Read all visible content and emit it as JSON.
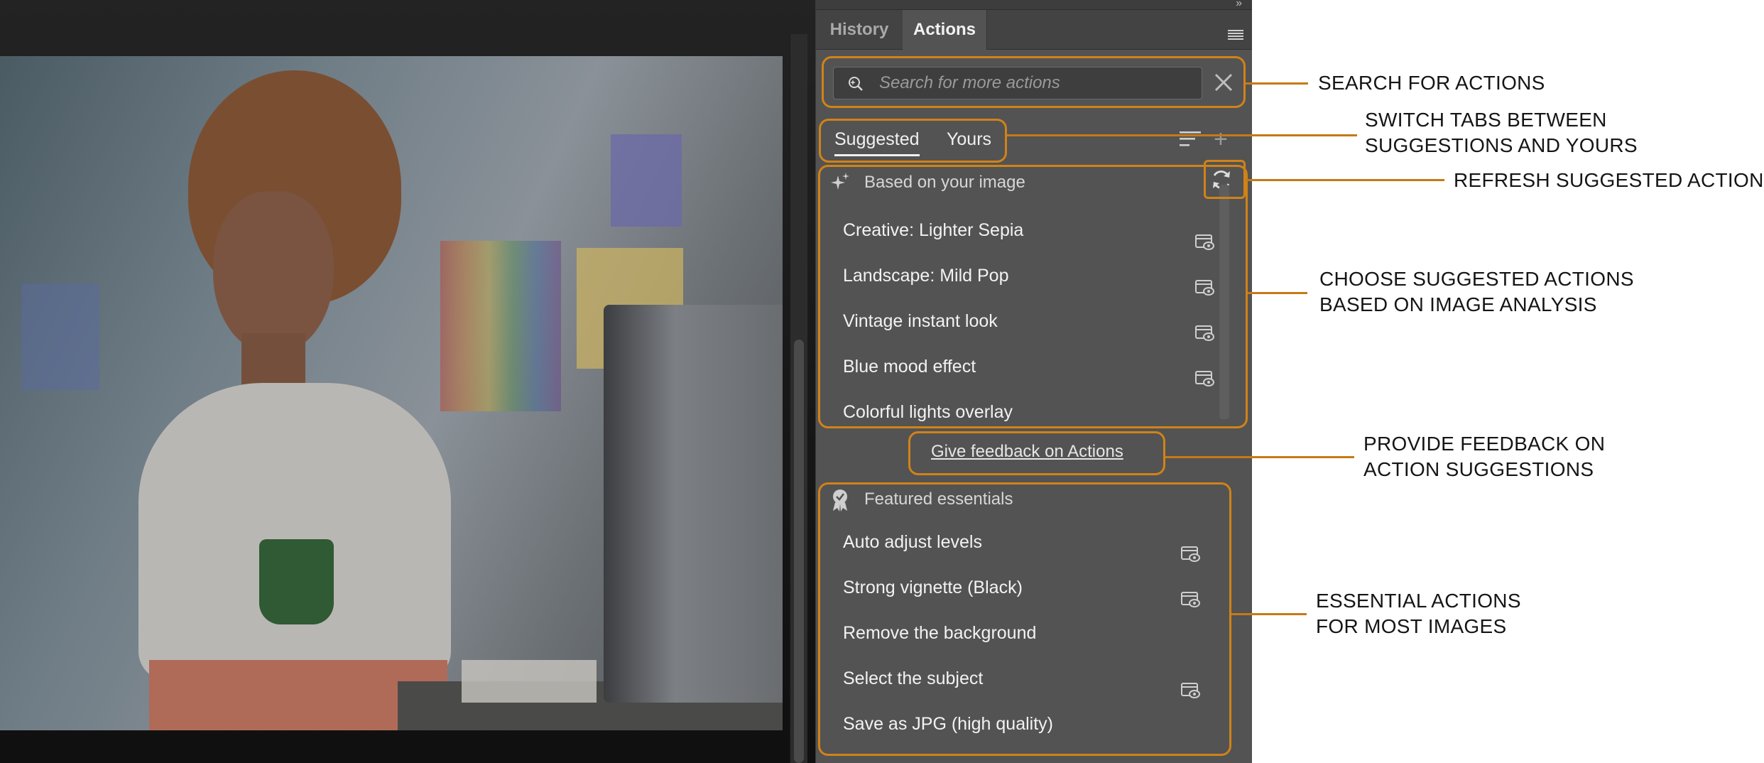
{
  "panel": {
    "tabs": [
      {
        "label": "History",
        "active": false
      },
      {
        "label": "Actions",
        "active": true
      }
    ],
    "search": {
      "placeholder": "Search for more actions",
      "value": ""
    },
    "subtabs": [
      {
        "label": "Suggested",
        "active": true
      },
      {
        "label": "Yours",
        "active": false
      }
    ],
    "suggested_group": {
      "title": "Based on your image",
      "items": [
        {
          "label": "Creative: Lighter Sepia",
          "preview": true
        },
        {
          "label": "Landscape: Mild Pop",
          "preview": true
        },
        {
          "label": "Vintage instant look",
          "preview": true
        },
        {
          "label": "Blue mood effect",
          "preview": true
        },
        {
          "label": "Colorful lights overlay",
          "preview": false
        }
      ]
    },
    "feedback_link": "Give feedback on Actions",
    "featured_group": {
      "title": "Featured essentials",
      "items": [
        {
          "label": "Auto adjust levels",
          "preview": true
        },
        {
          "label": "Strong vignette (Black)",
          "preview": true
        },
        {
          "label": "Remove the background",
          "preview": false
        },
        {
          "label": "Select the subject",
          "preview": true
        },
        {
          "label": "Save as JPG (high quality)",
          "preview": false
        }
      ]
    }
  },
  "callouts": {
    "search": [
      "SEARCH FOR ACTIONS"
    ],
    "tabs": [
      "SWITCH TABS BETWEEN",
      "SUGGESTIONS AND YOURS"
    ],
    "refresh": [
      "REFRESH SUGGESTED ACTIONS"
    ],
    "suggested": [
      "CHOOSE SUGGESTED ACTIONS",
      "BASED ON IMAGE ANALYSIS"
    ],
    "feedback": [
      "PROVIDE FEEDBACK ON",
      "ACTION SUGGESTIONS"
    ],
    "essentials": [
      "ESSENTIAL ACTIONS",
      "FOR MOST IMAGES"
    ]
  },
  "icons": {
    "search": "search-sparkle-icon",
    "clear": "close-icon",
    "sort": "sort-icon",
    "add": "plus-icon",
    "suggested_group": "sparkle-icon",
    "featured_group": "badge-check-icon",
    "refresh": "refresh-icon",
    "item_preview": "preview-eye-icon"
  },
  "colors": {
    "highlight": "#d08318",
    "panel_bg": "#535353",
    "tabbar_bg": "#434343"
  }
}
